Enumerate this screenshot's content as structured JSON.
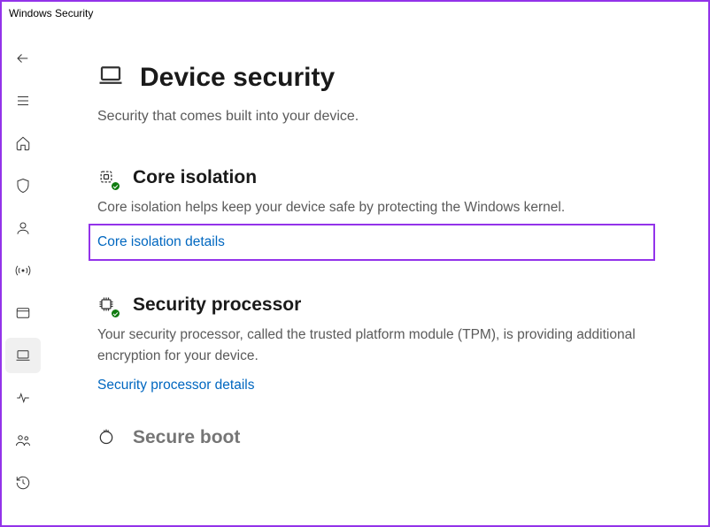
{
  "window": {
    "title": "Windows Security"
  },
  "sidebar": {
    "items": [
      {
        "name": "back",
        "label": "Back"
      },
      {
        "name": "menu",
        "label": "Menu"
      },
      {
        "name": "home",
        "label": "Home"
      },
      {
        "name": "virus",
        "label": "Virus & threat protection"
      },
      {
        "name": "account",
        "label": "Account protection"
      },
      {
        "name": "firewall",
        "label": "Firewall & network protection"
      },
      {
        "name": "app",
        "label": "App & browser control"
      },
      {
        "name": "device",
        "label": "Device security"
      },
      {
        "name": "performance",
        "label": "Device performance & health"
      },
      {
        "name": "family",
        "label": "Family options"
      },
      {
        "name": "history",
        "label": "Protection history"
      }
    ]
  },
  "main": {
    "title": "Device security",
    "subtitle": "Security that comes built into your device.",
    "sections": {
      "core": {
        "title": "Core isolation",
        "desc": "Core isolation helps keep your device safe by protecting the Windows kernel.",
        "link": "Core isolation details"
      },
      "processor": {
        "title": "Security processor",
        "desc": "Your security processor, called the trusted platform module (TPM), is providing additional encryption for your device.",
        "link": "Security processor details"
      },
      "boot": {
        "title": "Secure boot"
      }
    }
  }
}
